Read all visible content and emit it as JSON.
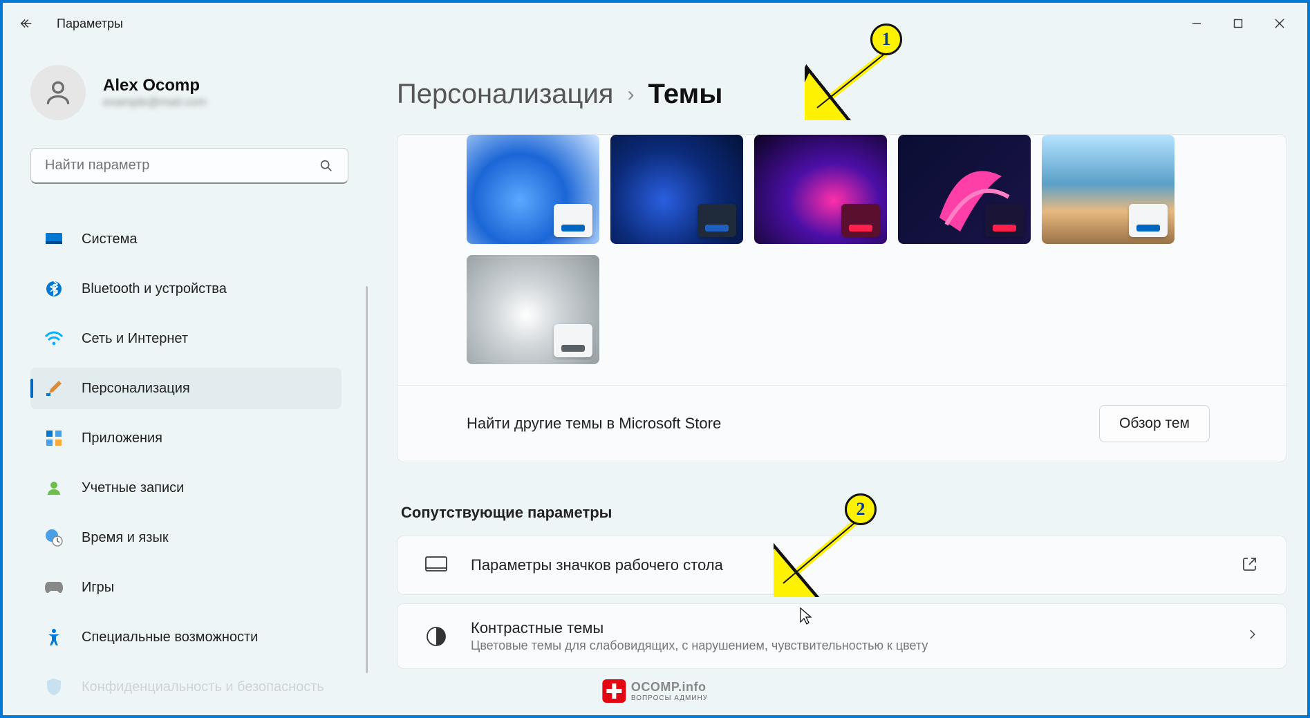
{
  "app": {
    "title": "Параметры"
  },
  "user": {
    "name": "Alex Ocomp",
    "email": "example@mail.com"
  },
  "search": {
    "placeholder": "Найти параметр"
  },
  "nav": [
    {
      "label": "Система",
      "icon": "system"
    },
    {
      "label": "Bluetooth и устройства",
      "icon": "bluetooth"
    },
    {
      "label": "Сеть и Интернет",
      "icon": "network"
    },
    {
      "label": "Персонализация",
      "icon": "personalize",
      "active": true
    },
    {
      "label": "Приложения",
      "icon": "apps"
    },
    {
      "label": "Учетные записи",
      "icon": "accounts"
    },
    {
      "label": "Время и язык",
      "icon": "time"
    },
    {
      "label": "Игры",
      "icon": "gaming"
    },
    {
      "label": "Специальные возможности",
      "icon": "accessibility"
    },
    {
      "label": "Конфиденциальность и безопасность",
      "icon": "privacy"
    }
  ],
  "breadcrumb": {
    "parent": "Персонализация",
    "current": "Темы"
  },
  "themes": [
    {
      "name": "windows-light",
      "bg_style": "radial-gradient(circle at 40% 60%, #5aa8ff 0%, #1b66d6 45%, #cfe6ff 100%)",
      "swatch_bg": "#f4f5f6",
      "accent": "#0067c0"
    },
    {
      "name": "windows-dark",
      "bg_style": "radial-gradient(circle at 40% 60%, #2a5fe0 0%, #0b2a78 50%, #04123a 100%)",
      "swatch_bg": "#1f2a3a",
      "accent": "#1f5fbf"
    },
    {
      "name": "glow",
      "bg_style": "radial-gradient(ellipse at 60% 60%, #ff2fa8 0%, #4b0fa6 40%, #0b0320 100%)",
      "swatch_bg": "#5a0f2f",
      "accent": "#ff1f4b"
    },
    {
      "name": "flower",
      "bg_style": "linear-gradient(135deg, #0a0e33 0%, #1a1347 100%)",
      "swatch_bg": "#1a1536",
      "accent": "#ff1f4b"
    },
    {
      "name": "sunrise",
      "bg_style": "linear-gradient(180deg, #b6e3ff 0%, #5aa0c8 45%, #e8b980 70%, #9a7348 100%)",
      "swatch_bg": "#f4f5f6",
      "accent": "#0067c0"
    },
    {
      "name": "gray-swirl",
      "bg_style": "radial-gradient(circle at 45% 55%, #ffffff 0%, #cfd5d8 35%, #8f989c 100%)",
      "swatch_bg": "#f4f5f6",
      "accent": "#5a6166"
    }
  ],
  "store": {
    "label": "Найти другие темы в Microsoft Store",
    "button": "Обзор тем"
  },
  "related": {
    "heading": "Сопутствующие параметры",
    "items": [
      {
        "title": "Параметры значков рабочего стола",
        "desc": "",
        "action": "external"
      },
      {
        "title": "Контрастные темы",
        "desc": "Цветовые темы для слабовидящих, с нарушением, чувствительностью к цвету",
        "action": "chevron"
      }
    ]
  },
  "annotations": {
    "one": "1",
    "two": "2"
  },
  "watermark": {
    "brand": "OCOMP",
    "suffix": ".info",
    "tagline": "ВОПРОСЫ АДМИНУ"
  }
}
